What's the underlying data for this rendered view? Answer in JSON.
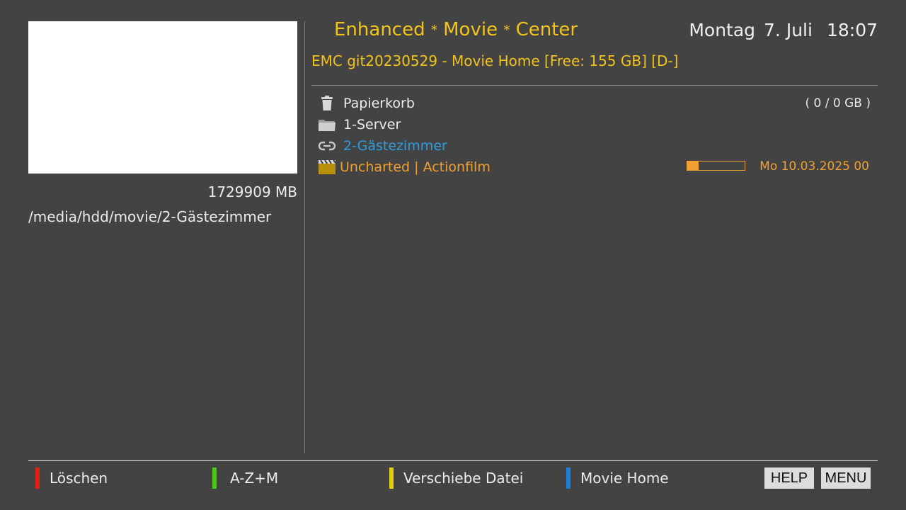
{
  "sidebar": {
    "size": "1729909 MB",
    "path": "/media/hdd/movie/2-Gästezimmer"
  },
  "header": {
    "title_parts": [
      "Enhanced",
      "Movie",
      "Center"
    ],
    "title_separator": "*",
    "day": "Montag",
    "date": "7. Juli",
    "time": "18:07",
    "subtitle": "EMC git20230529 - Movie Home [Free: 155 GB] [D-]"
  },
  "list": {
    "items": [
      {
        "icon": "trash-icon",
        "label": "Papierkorb",
        "info": "( 0 / 0 GB )"
      },
      {
        "icon": "folder-icon",
        "label": "1-Server"
      },
      {
        "icon": "link-icon",
        "label": "2-Gästezimmer",
        "color": "#2f9be0"
      },
      {
        "icon": "movie-clapper-icon",
        "label": "Uncharted | Actionfilm",
        "progress": 0.2,
        "date": "Mo 10.03.2025 00",
        "color": "#f0a030"
      }
    ]
  },
  "footer": {
    "keys": [
      {
        "color": "#e02010",
        "label": "Löschen"
      },
      {
        "color": "#44cc10",
        "label": "A-Z+M"
      },
      {
        "color": "#e0d010",
        "label": "Verschiebe Datei"
      },
      {
        "color": "#1a7fd8",
        "label": "Movie Home"
      }
    ],
    "help": "HELP",
    "menu": "MENU"
  },
  "colors": {
    "background": "#434343",
    "accent_title": "#f2c31a",
    "selection": "#2f9be0",
    "movie": "#f0a030"
  }
}
